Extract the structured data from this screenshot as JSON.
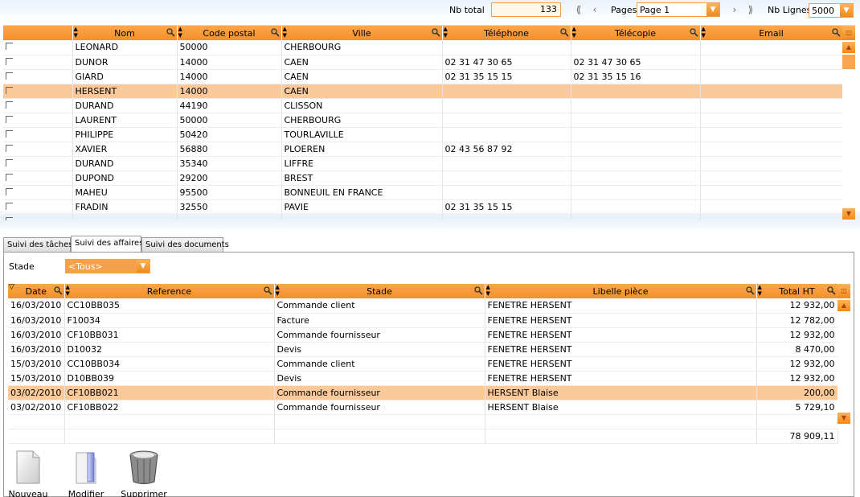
{
  "pager": {
    "nb_total_label": "Nb total",
    "nb_total_value": "133",
    "pages_label": "Pages",
    "page_value": "Page 1",
    "nb_lignes_label": "Nb Lignes",
    "nb_lignes_value": "5000"
  },
  "clients_table": {
    "columns": [
      "Nom",
      "Code postal",
      "Ville",
      "Téléphone",
      "Télécopie",
      "Email"
    ],
    "rows": [
      {
        "nom": "LEONARD",
        "cp": "50000",
        "ville": "CHERBOURG",
        "tel": "",
        "fax": "",
        "email": ""
      },
      {
        "nom": "DUNOR",
        "cp": "14000",
        "ville": "CAEN",
        "tel": "02 31 47 30 65",
        "fax": "02 31 47 30 65",
        "email": ""
      },
      {
        "nom": "GIARD",
        "cp": "14000",
        "ville": "CAEN",
        "tel": "02 31 35 15 15",
        "fax": "02 31 35 15 16",
        "email": ""
      },
      {
        "nom": "HERSENT",
        "cp": "14000",
        "ville": "CAEN",
        "tel": "",
        "fax": "",
        "email": ""
      },
      {
        "nom": "DURAND",
        "cp": "44190",
        "ville": "CLISSON",
        "tel": "",
        "fax": "",
        "email": ""
      },
      {
        "nom": "LAURENT",
        "cp": "50000",
        "ville": "CHERBOURG",
        "tel": "",
        "fax": "",
        "email": ""
      },
      {
        "nom": "PHILIPPE",
        "cp": "50420",
        "ville": "TOURLAVILLE",
        "tel": "",
        "fax": "",
        "email": ""
      },
      {
        "nom": "XAVIER",
        "cp": "56880",
        "ville": "PLOEREN",
        "tel": "02 43 56 87 92",
        "fax": "",
        "email": ""
      },
      {
        "nom": "DURAND",
        "cp": "35340",
        "ville": "LIFFRE",
        "tel": "",
        "fax": "",
        "email": ""
      },
      {
        "nom": "DUPOND",
        "cp": "29200",
        "ville": "BREST",
        "tel": "",
        "fax": "",
        "email": ""
      },
      {
        "nom": "MAHEU",
        "cp": "95500",
        "ville": "BONNEUIL EN FRANCE",
        "tel": "",
        "fax": "",
        "email": ""
      },
      {
        "nom": "FRADIN",
        "cp": "32550",
        "ville": "PAVIE",
        "tel": "02 31 35 15 15",
        "fax": "",
        "email": ""
      }
    ]
  },
  "tabs": [
    "Suivi des tâches",
    "Suivi des affaires",
    "Suivi des documents"
  ],
  "stade_filter": {
    "label": "Stade",
    "value": "<Tous>"
  },
  "affaires_table": {
    "columns": [
      "Date",
      "Reference",
      "Stade",
      "Libelle pièce",
      "Total HT"
    ],
    "rows": [
      {
        "date": "16/03/2010",
        "ref": "CC10BB035",
        "stade": "Commande client",
        "libelle": "FENETRE HERSENT",
        "total": "12 932,00"
      },
      {
        "date": "16/03/2010",
        "ref": "F10034",
        "stade": "Facture",
        "libelle": "FENETRE HERSENT",
        "total": "12 782,00"
      },
      {
        "date": "16/03/2010",
        "ref": "CF10BB031",
        "stade": "Commande fournisseur",
        "libelle": "FENETRE HERSENT",
        "total": "12 932,00"
      },
      {
        "date": "16/03/2010",
        "ref": "D10032",
        "stade": "Devis",
        "libelle": "FENETRE HERSENT",
        "total": "8 470,00"
      },
      {
        "date": "15/03/2010",
        "ref": "CC10BB034",
        "stade": "Commande client",
        "libelle": "FENETRE HERSENT",
        "total": "12 932,00"
      },
      {
        "date": "15/03/2010",
        "ref": "D10BB039",
        "stade": "Devis",
        "libelle": "FENETRE HERSENT",
        "total": "12 932,00"
      },
      {
        "date": "03/02/2010",
        "ref": "CF10BB021",
        "stade": "Commande fournisseur",
        "libelle": "HERSENT Blaise",
        "total": "200,00"
      },
      {
        "date": "03/02/2010",
        "ref": "CF10BB022",
        "stade": "Commande fournisseur",
        "libelle": "HERSENT Blaise",
        "total": "5 729,10"
      }
    ],
    "grand_total": "78 909,11"
  },
  "actions": {
    "new_label": "Nouveau",
    "edit_label": "Modifier",
    "delete_label": "Supprimer"
  },
  "colors": {
    "accent": "#f4902a",
    "selected_row": "#fbc99a"
  }
}
